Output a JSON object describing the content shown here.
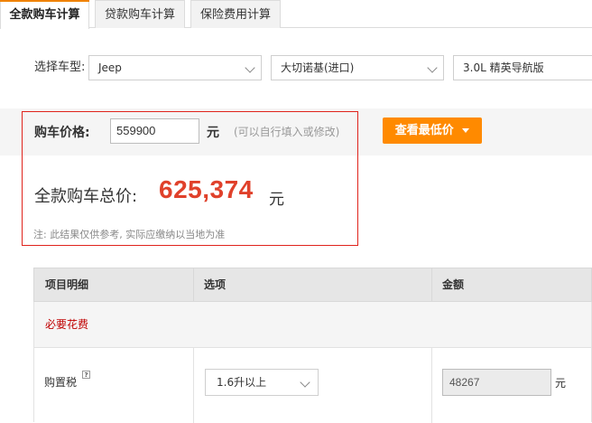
{
  "tabs": [
    {
      "label": "全款购车计算",
      "active": true
    },
    {
      "label": "贷款购车计算",
      "active": false
    },
    {
      "label": "保险费用计算",
      "active": false
    }
  ],
  "accent_color": "#f08200",
  "selector": {
    "label": "选择车型:",
    "brand": "Jeep",
    "series": "大切诺基(进口)",
    "model": "3.0L 精英导航版"
  },
  "price": {
    "label": "购车价格:",
    "value": "559900",
    "unit": "元",
    "hint": "(可以自行填入或修改)",
    "lowest_price_button": "查看最低价"
  },
  "total": {
    "label": "全款购车总价:",
    "value": "625,374",
    "unit": "元"
  },
  "note": "注: 此结果仅供参考, 实际应缴纳以当地为准",
  "table": {
    "headers": [
      "项目明细",
      "选项",
      "金额"
    ],
    "section": "必要花费",
    "rows": [
      {
        "label": "购置税",
        "help_icon": "question-icon",
        "option": "1.6升以上",
        "amount": "48267",
        "unit": "元"
      }
    ]
  }
}
